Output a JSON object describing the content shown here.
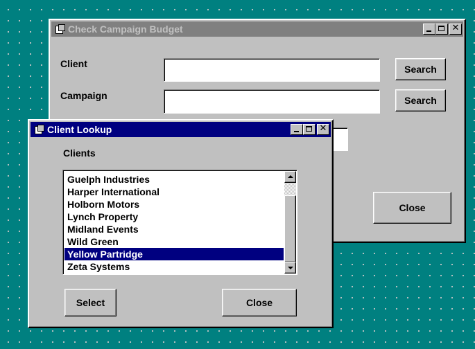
{
  "campaign_window": {
    "title": "Check Campaign Budget",
    "client_label": "Client",
    "client_value": "",
    "campaign_label": "Campaign",
    "campaign_value": "",
    "search_client_label": "Search",
    "search_campaign_label": "Search",
    "close_label": "Close"
  },
  "lookup_window": {
    "title": "Client Lookup",
    "clients_label": "Clients",
    "clients": [
      "Guelph Industries",
      "Harper International",
      "Holborn Motors",
      "Lynch Property",
      "Midland Events",
      "Wild Green",
      "Yellow Partridge",
      "Zeta Systems"
    ],
    "selected_client": "Yellow Partridge",
    "select_label": "Select",
    "close_label": "Close"
  },
  "title_buttons": {
    "minimize_icon": "minimize-icon",
    "maximize_icon": "maximize-icon",
    "close_glyph": "✕"
  },
  "colors": {
    "desktop": "#008080",
    "active_title": "#000080",
    "inactive_title": "#808080",
    "window_face": "#c0c0c0",
    "selection": "#000080"
  }
}
